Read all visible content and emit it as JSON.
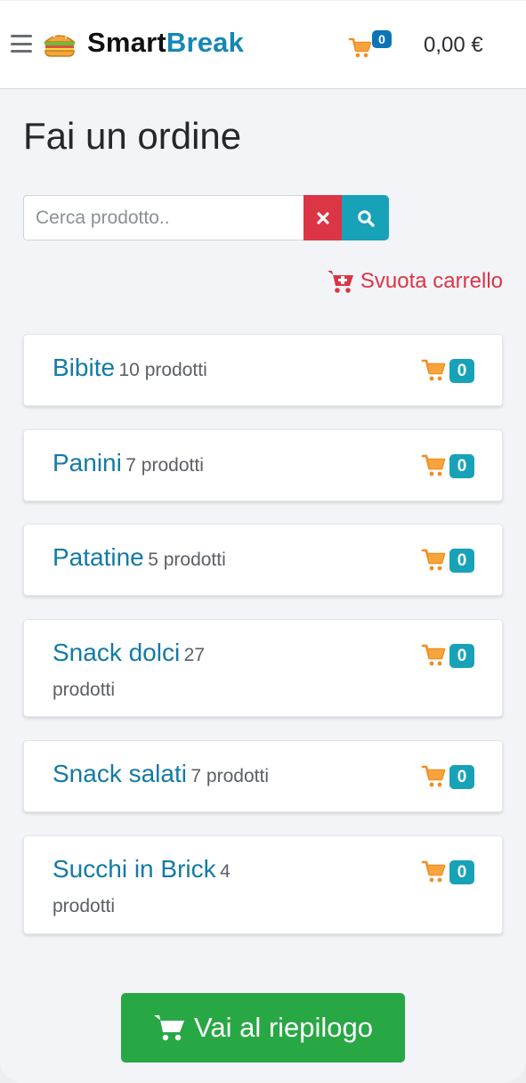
{
  "header": {
    "brand_part1": "Smart",
    "brand_part2": "Break",
    "cart_count": "0",
    "total": "0,00 €",
    "icons": [
      "menu-icon",
      "sandwich-logo-icon",
      "cart-icon"
    ]
  },
  "main": {
    "title": "Fai un ordine",
    "search": {
      "placeholder": "Cerca prodotto..",
      "value": ""
    },
    "empty_cart_label": "Svuota carrello",
    "categories": [
      {
        "name": "Bibite",
        "count": "10 prodotti",
        "in_cart": "0"
      },
      {
        "name": "Panini",
        "count": "7 prodotti",
        "in_cart": "0"
      },
      {
        "name": "Patatine",
        "count": "5 prodotti",
        "in_cart": "0"
      },
      {
        "name": "Snack dolci",
        "count": "27 prodotti",
        "in_cart": "0"
      },
      {
        "name": "Snack salati",
        "count": "7 prodotti",
        "in_cart": "0"
      },
      {
        "name": "Succhi in Brick",
        "count": "4 prodotti",
        "in_cart": "0"
      }
    ],
    "summary_button_label": "Vai al riepilogo"
  },
  "colors": {
    "brand_blue": "#1687b4",
    "link_blue": "#137aa6",
    "danger": "#dc3545",
    "info": "#17a2b8",
    "success": "#28a745",
    "cart_orange": "#f28c1e",
    "badge_dark_blue": "#0e74b5"
  }
}
